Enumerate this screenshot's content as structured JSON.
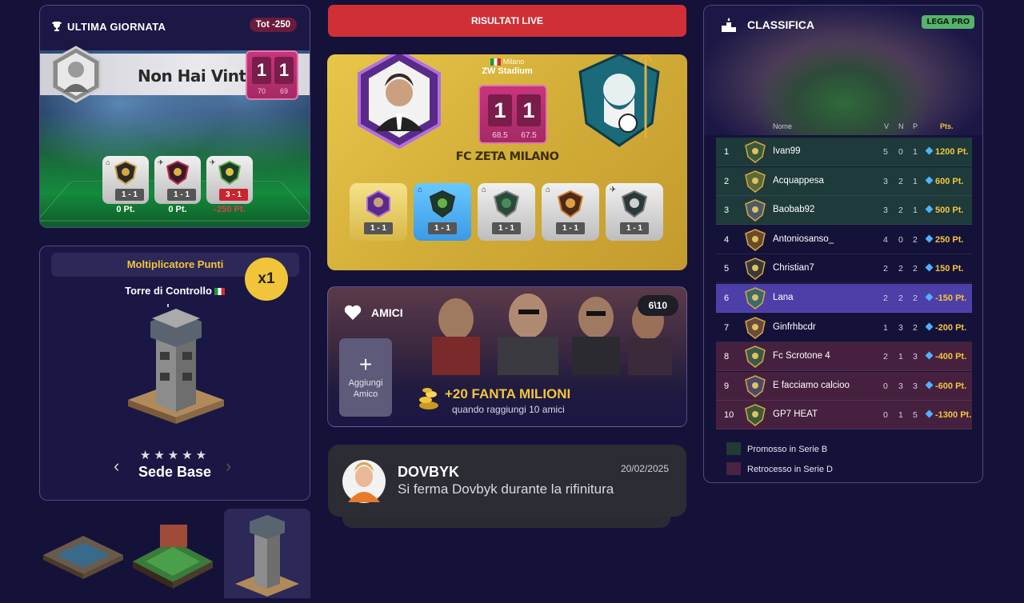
{
  "ultima_giornata": {
    "title": "ULTIMA GIORNATA",
    "total": "Tot -250",
    "player_name": "Non Hai Vinto",
    "score_home": "1",
    "score_away": "1",
    "sub_home": "70",
    "sub_away": "69",
    "matches": [
      {
        "result": "1 - 1",
        "points": "0 Pt.",
        "venue_icon": "home-icon",
        "lost": false
      },
      {
        "result": "1 - 1",
        "points": "0 Pt.",
        "venue_icon": "plane-icon",
        "lost": false
      },
      {
        "result": "3 - 1",
        "points": "-250 Pt.",
        "venue_icon": "plane-icon",
        "lost": true
      }
    ]
  },
  "multiplier": {
    "title": "Moltiplicatore Punti",
    "badge": "x1",
    "building": "Torre di Controllo",
    "stars": "★★★★★",
    "level_name": "Sede Base"
  },
  "live_button": "RISULTATI LIVE",
  "match": {
    "city": "Milano",
    "stadium": "ZW Stadium",
    "score_home": "1",
    "score_away": "1",
    "sub_home": "68.5",
    "sub_away": "67.5",
    "team_name": "FC ZETA MILANO",
    "fixtures": [
      {
        "result": "1 - 1",
        "style": "gold",
        "venue_icon": ""
      },
      {
        "result": "1 - 1",
        "style": "blue",
        "venue_icon": "home-icon"
      },
      {
        "result": "1 - 1",
        "style": "silver",
        "venue_icon": "home-icon"
      },
      {
        "result": "1 - 1",
        "style": "silver",
        "venue_icon": "home-icon"
      },
      {
        "result": "1 - 1",
        "style": "silver",
        "venue_icon": "plane-icon"
      }
    ]
  },
  "amici": {
    "title": "AMICI",
    "count": "6\\10",
    "add_label_1": "Aggiungi",
    "add_label_2": "Amico",
    "reward": "+20 FANTA MILIONI",
    "reward_sub": "quando raggiungi 10 amici"
  },
  "news": {
    "name": "DOVBYK",
    "date": "20/02/2025",
    "text": "Si ferma Dovbyk durante la rifinitura"
  },
  "classifica": {
    "title": "CLASSIFICA",
    "league_badge": "LEGA PRO",
    "headers": {
      "name": "Nome",
      "v": "V",
      "n": "N",
      "p": "P",
      "pts": "Pts."
    },
    "rows": [
      {
        "pos": "1",
        "name": "Ivan99",
        "v": "5",
        "n": "0",
        "p": "1",
        "pts": "1200 Pt.",
        "zone": "promo"
      },
      {
        "pos": "2",
        "name": "Acquappesa",
        "v": "3",
        "n": "2",
        "p": "1",
        "pts": "600 Pt.",
        "zone": "promo"
      },
      {
        "pos": "3",
        "name": "Baobab92",
        "v": "3",
        "n": "2",
        "p": "1",
        "pts": "500 Pt.",
        "zone": "promo"
      },
      {
        "pos": "4",
        "name": "Antoniosanso_",
        "v": "4",
        "n": "0",
        "p": "2",
        "pts": "250 Pt.",
        "zone": "none"
      },
      {
        "pos": "5",
        "name": "Christian7",
        "v": "2",
        "n": "2",
        "p": "2",
        "pts": "150 Pt.",
        "zone": "none"
      },
      {
        "pos": "6",
        "name": "Lana",
        "v": "2",
        "n": "2",
        "p": "2",
        "pts": "-150 Pt.",
        "zone": "me"
      },
      {
        "pos": "7",
        "name": "Ginfrhbcdr",
        "v": "1",
        "n": "3",
        "p": "2",
        "pts": "-200 Pt.",
        "zone": "none"
      },
      {
        "pos": "8",
        "name": "Fc Scrotone 4",
        "v": "2",
        "n": "1",
        "p": "3",
        "pts": "-400 Pt.",
        "zone": "releg"
      },
      {
        "pos": "9",
        "name": "E facciamo calcioo",
        "v": "0",
        "n": "3",
        "p": "3",
        "pts": "-600 Pt.",
        "zone": "releg"
      },
      {
        "pos": "10",
        "name": "GP7 HEAT",
        "v": "0",
        "n": "1",
        "p": "5",
        "pts": "-1300 Pt.",
        "zone": "releg"
      }
    ],
    "legend_promo": "Promosso in Serie B",
    "legend_releg": "Retrocesso in Serie D",
    "colors": {
      "promo": "#1e3a3a",
      "releg": "#46213f",
      "me": "#4d3fa8",
      "none": "#15123a"
    }
  }
}
